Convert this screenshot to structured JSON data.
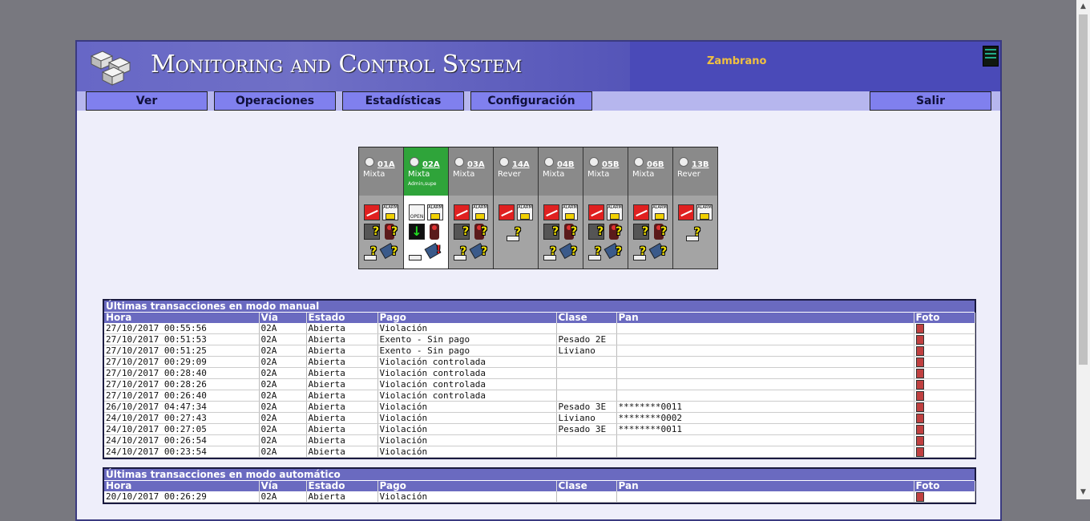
{
  "app": {
    "title": "Monitoring and Control System",
    "user": "Zambrano"
  },
  "menu": {
    "ver": "Ver",
    "operaciones": "Operaciones",
    "estadisticas": "Estadísticas",
    "configuracion": "Configuración",
    "salir": "Salir"
  },
  "lanes": [
    {
      "code": "01A",
      "mode": "Mixta",
      "user": ""
    },
    {
      "code": "02A",
      "mode": "Mixta",
      "user": "Admin,supe"
    },
    {
      "code": "03A",
      "mode": "Mixta",
      "user": ""
    },
    {
      "code": "14A",
      "mode": "Rever",
      "user": ""
    },
    {
      "code": "04B",
      "mode": "Mixta",
      "user": ""
    },
    {
      "code": "05B",
      "mode": "Mixta",
      "user": ""
    },
    {
      "code": "06B",
      "mode": "Mixta",
      "user": ""
    },
    {
      "code": "13B",
      "mode": "Rever",
      "user": ""
    }
  ],
  "icons": {
    "alarm": "ALARM",
    "open": "OPEN"
  },
  "manual": {
    "title": "Últimas transacciones en modo manual",
    "headers": [
      "Hora",
      "Vía",
      "Estado",
      "Pago",
      "Clase",
      "Pan",
      "Foto"
    ],
    "rows": [
      [
        "27/10/2017 00:55:56",
        "02A",
        "Abierta",
        "Violación",
        "",
        ""
      ],
      [
        "27/10/2017 00:51:53",
        "02A",
        "Abierta",
        "Exento - Sin pago",
        "Pesado 2E",
        ""
      ],
      [
        "27/10/2017 00:51:25",
        "02A",
        "Abierta",
        "Exento - Sin pago",
        "Liviano",
        ""
      ],
      [
        "27/10/2017 00:29:09",
        "02A",
        "Abierta",
        "Violación controlada",
        "",
        ""
      ],
      [
        "27/10/2017 00:28:40",
        "02A",
        "Abierta",
        "Violación controlada",
        "",
        ""
      ],
      [
        "27/10/2017 00:28:26",
        "02A",
        "Abierta",
        "Violación controlada",
        "",
        ""
      ],
      [
        "27/10/2017 00:26:40",
        "02A",
        "Abierta",
        "Violación controlada",
        "",
        ""
      ],
      [
        "26/10/2017 04:47:34",
        "02A",
        "Abierta",
        "Violación",
        "Pesado 3E",
        "********0011"
      ],
      [
        "24/10/2017 00:27:43",
        "02A",
        "Abierta",
        "Violación",
        "Liviano",
        "********0002"
      ],
      [
        "24/10/2017 00:27:05",
        "02A",
        "Abierta",
        "Violación",
        "Pesado 3E",
        "********0011"
      ],
      [
        "24/10/2017 00:26:54",
        "02A",
        "Abierta",
        "Violación",
        "",
        ""
      ],
      [
        "24/10/2017 00:23:54",
        "02A",
        "Abierta",
        "Violación",
        "",
        ""
      ]
    ]
  },
  "auto": {
    "title": "Últimas transacciones en modo automático",
    "headers": [
      "Hora",
      "Vía",
      "Estado",
      "Pago",
      "Clase",
      "Pan",
      "Foto"
    ],
    "rows": [
      [
        "20/10/2017 00:26:29",
        "02A",
        "Abierta",
        "Violación",
        "",
        ""
      ]
    ]
  }
}
